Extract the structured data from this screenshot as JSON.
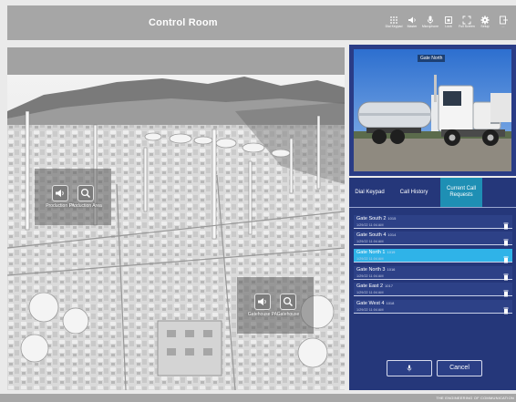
{
  "header": {
    "title": "Control Room",
    "buttons": [
      {
        "icon": "dial-keypad-icon",
        "label": "Dial Keypad"
      },
      {
        "icon": "speaker-icon",
        "label": "Master"
      },
      {
        "icon": "microphone-icon",
        "label": "Microphone"
      },
      {
        "icon": "lock-icon",
        "label": "Lock"
      },
      {
        "icon": "full-screen-icon",
        "label": "Full Screen"
      },
      {
        "icon": "gear-icon",
        "label": "Setup"
      },
      {
        "icon": "exit-icon",
        "label": "..."
      }
    ]
  },
  "map": {
    "zones": [
      {
        "labels": [
          "Production PA",
          "Production Area"
        ]
      },
      {
        "labels": [
          "Gatehouse PA",
          "Gatehouse"
        ]
      }
    ]
  },
  "camera": {
    "label": "Gate North"
  },
  "calls": {
    "tabs": [
      {
        "label": "Dial Keypad",
        "active": false
      },
      {
        "label": "Call History",
        "active": false
      },
      {
        "label": "Current Call Requests",
        "active": true
      }
    ],
    "requests": [
      {
        "name": "Gate South 2",
        "id": "1015",
        "time": "1/29/22 11:04 AM",
        "selected": false
      },
      {
        "name": "Gate South 4",
        "id": "1014",
        "time": "1/29/22 11:04 AM",
        "selected": false
      },
      {
        "name": "Gate North 1",
        "id": "1019",
        "time": "1/29/22 11:04 AM",
        "selected": true
      },
      {
        "name": "Gate North 3",
        "id": "1016",
        "time": "1/29/22 11:04 AM",
        "selected": false
      },
      {
        "name": "Gate East 2",
        "id": "1017",
        "time": "1/29/22 11:04 AM",
        "selected": false
      },
      {
        "name": "Gate West 4",
        "id": "1018",
        "time": "1/29/22 11:04 AM",
        "selected": false
      }
    ],
    "mic_icon": "microphone-icon",
    "cancel_label": "Cancel"
  },
  "footer": {
    "brand": "THE ENGINEERING OF COMMUNICATION"
  },
  "colors": {
    "header": "#a6a6a6",
    "panel": "#25377a",
    "active_tab": "#1e8fb4",
    "selected_row": "#2fb3e8"
  }
}
